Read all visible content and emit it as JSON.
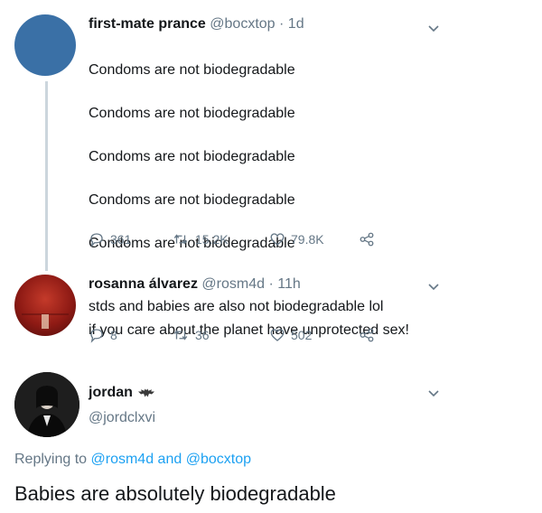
{
  "tweet1": {
    "name": "first-mate prance",
    "handle": "@bocxtop",
    "separator": "·",
    "time": "1d",
    "lines": [
      "Condoms are not biodegradable",
      "Condoms are not biodegradable",
      "Condoms are not biodegradable",
      "Condoms are not biodegradable",
      "Condoms are not biodegradable"
    ],
    "text2": "if you care about the planet have unprotected sex!",
    "replies": "361",
    "retweets": "15.2K",
    "likes": "79.8K",
    "avatar_color": "#3a70a6"
  },
  "tweet2": {
    "name": "rosanna álvarez",
    "handle": "@rosm4d",
    "separator": "·",
    "time": "11h",
    "text": "stds and babies are also not biodegradable lol",
    "replies": "8",
    "retweets": "36",
    "likes": "502",
    "avatar_color": "#9c1e1e"
  },
  "tweet3": {
    "name": "jordan",
    "handle": "@jordclxvi",
    "reply_prefix": "Replying to",
    "reply_user1": "@rosm4d",
    "reply_and": "and",
    "reply_user2": "@bocxtop",
    "text": "Babies are absolutely biodegradable"
  },
  "icons": {
    "reply": "reply-icon",
    "retweet": "retweet-icon",
    "like": "heart-icon",
    "share": "share-icon",
    "caret": "chevron-down-icon",
    "badge": "bat-emblem-icon"
  },
  "colors": {
    "text_primary": "#14171a",
    "text_secondary": "#657786",
    "link": "#1da1f2",
    "thread_line": "#ccd6dd"
  }
}
